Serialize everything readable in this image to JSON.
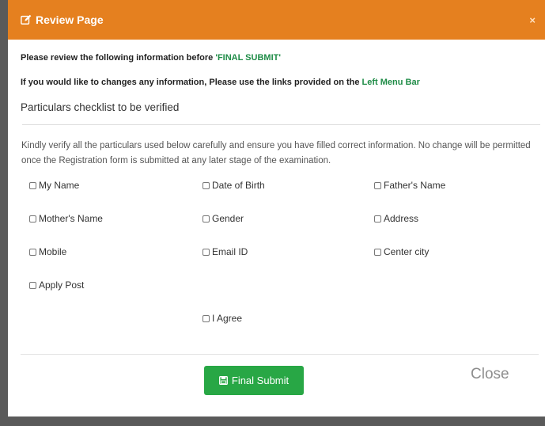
{
  "header": {
    "title": "Review Page",
    "close_glyph": "×"
  },
  "notice": {
    "line1_prefix": "Please review the following information before ",
    "line1_highlight": "'FINAL SUBMIT'",
    "line2_prefix": "If you would like to changes any information, Please use the links provided on the ",
    "line2_highlight": "Left Menu Bar"
  },
  "subheading": "Particulars checklist to be verified",
  "instructions": "Kindly verify all the particulars used below carefully and ensure you have filled correct information. No change will be permitted once the Registration form is submitted at any later stage of the examination.",
  "checklist": {
    "my_name": "My Name",
    "date_of_birth": "Date of Birth",
    "fathers_name": "Father's Name",
    "mothers_name": "Mother's Name",
    "gender": "Gender",
    "address": "Address",
    "mobile": "Mobile",
    "email_id": "Email ID",
    "center_city": "Center city",
    "apply_post": "Apply Post",
    "i_agree": "I Agree"
  },
  "footer": {
    "final_submit_label": "Final Submit",
    "close_label": "Close"
  },
  "colors": {
    "header_bg": "#e5801f",
    "link_green": "#1f8c47",
    "button_green": "#28a745"
  }
}
